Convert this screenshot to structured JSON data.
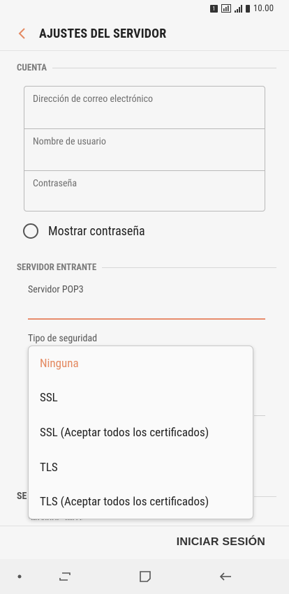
{
  "status_bar": {
    "sim": "1",
    "time": "10.00"
  },
  "header": {
    "title": "AJUSTES DEL SERVIDOR"
  },
  "account": {
    "section_label": "CUENTA",
    "email_placeholder": "Dirección de correo electrónico",
    "username_placeholder": "Nombre de usuario",
    "password_placeholder": "Contraseña",
    "show_password_label": "Mostrar contraseña"
  },
  "incoming": {
    "section_label": "SERVIDOR ENTRANTE",
    "pop3_label": "Servidor POP3",
    "security_label": "Tipo de seguridad"
  },
  "security_dropdown": {
    "selected": "Ninguna",
    "options": [
      "Ninguna",
      "SSL",
      "SSL (Aceptar todos los certificados)",
      "TLS",
      "TLS (Aceptar todos los certificados)"
    ]
  },
  "outgoing": {
    "partial_section_label": "SE",
    "smtp_label": "Servidor SMTP"
  },
  "footer": {
    "login_button": "INICIAR SESIÓN"
  },
  "colors": {
    "accent": "#e48a62",
    "background": "#f6f6f6"
  }
}
